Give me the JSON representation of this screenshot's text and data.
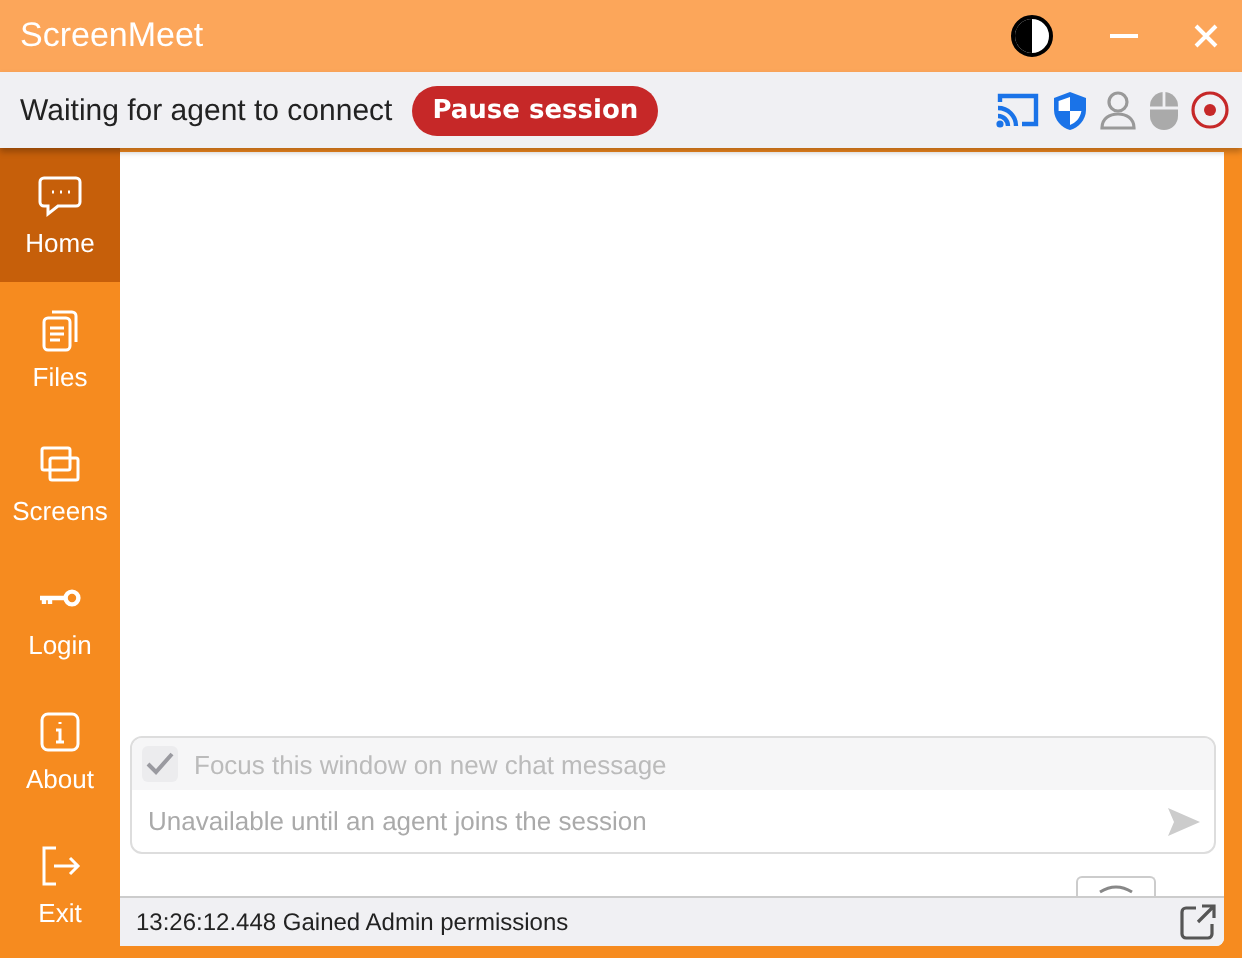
{
  "window": {
    "title": "ScreenMeet"
  },
  "session_bar": {
    "status": "Waiting for agent to connect",
    "pause_button": "Pause session"
  },
  "sidebar": {
    "items": [
      {
        "kind": "chat",
        "label": "Home",
        "selected": true
      },
      {
        "kind": "files",
        "label": "Files",
        "selected": false
      },
      {
        "kind": "screens",
        "label": "Screens",
        "selected": false
      },
      {
        "kind": "key",
        "label": "Login",
        "selected": false
      },
      {
        "kind": "info",
        "label": "About",
        "selected": false
      },
      {
        "kind": "exit",
        "label": "Exit",
        "selected": false
      }
    ]
  },
  "chat": {
    "focus_option": {
      "label": "Focus this window on new chat message",
      "checked": true,
      "disabled": true
    },
    "message_field": {
      "placeholder": "Unavailable until an agent joins the session"
    }
  },
  "status_bar": {
    "text": "13:26:12.448 Gained Admin permissions"
  }
}
